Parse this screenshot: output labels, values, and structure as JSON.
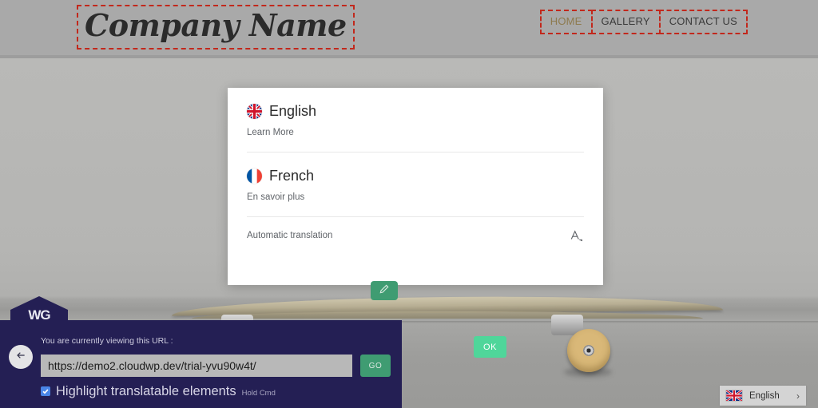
{
  "site": {
    "brand": "Company Name",
    "nav": [
      {
        "label": "HOME",
        "active": true
      },
      {
        "label": "GALLERY",
        "active": false
      },
      {
        "label": "CONTACT US",
        "active": false
      }
    ]
  },
  "dialog": {
    "languages": [
      {
        "name": "English",
        "sub": "Learn More",
        "flag": "uk-flag-icon"
      },
      {
        "name": "French",
        "sub": "En savoir plus",
        "flag": "france-flag-icon"
      }
    ],
    "auto_translation_label": "Automatic translation",
    "auto_translation_icon": "translate-icon",
    "ok_label": "OK"
  },
  "edit_button": {
    "icon": "pencil-icon"
  },
  "translator_panel": {
    "logo": "WG",
    "back_icon": "arrow-left-icon",
    "url_label": "You are currently viewing this URL :",
    "url_value": "https://demo2.cloudwp.dev/trial-yvu90w4t/",
    "url_placeholder": "https://",
    "go_label": "GO",
    "highlight_label": "Highlight translatable elements",
    "highlight_hint": "Hold Cmd",
    "highlight_checked": true
  },
  "language_switcher": {
    "label": "English",
    "flag": "uk-flag-icon",
    "chevron": "›"
  },
  "colors": {
    "panel_navy": "#241f54",
    "accent_green": "#4fd69a",
    "go_green": "#3f9c72",
    "highlight_red": "#c2281c",
    "nav_active": "#8d7a4e",
    "checkbox_blue": "#4a86e8"
  }
}
